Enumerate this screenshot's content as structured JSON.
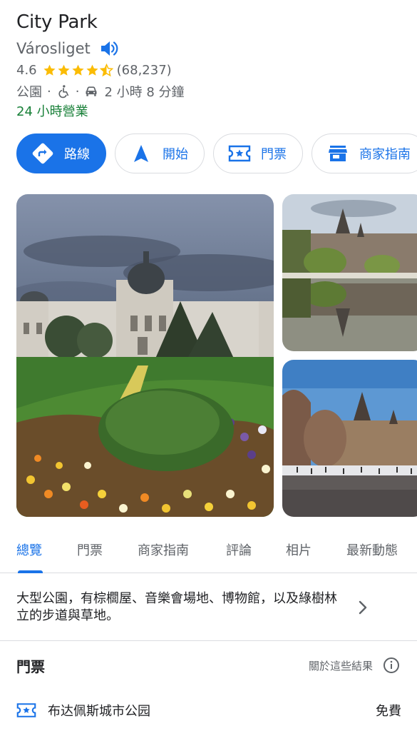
{
  "place": {
    "title": "City Park",
    "subtitle": "Városliget",
    "rating": "4.6",
    "stars": 4.6,
    "review_count": "(68,237)",
    "category": "公園",
    "dot": "·",
    "drive_time": "2 小時 8 分鐘",
    "hours_status": "24 小時營業"
  },
  "actions": [
    {
      "label": "路線",
      "icon": "directions-icon"
    },
    {
      "label": "開始",
      "icon": "navigation-arrow-icon"
    },
    {
      "label": "門票",
      "icon": "ticket-icon"
    },
    {
      "label": "商家指南",
      "icon": "store-icon"
    }
  ],
  "tabs": [
    {
      "label": "總覽",
      "active": true
    },
    {
      "label": "門票"
    },
    {
      "label": "商家指南"
    },
    {
      "label": "評論"
    },
    {
      "label": "相片"
    },
    {
      "label": "最新動態"
    }
  ],
  "description": "大型公園，有棕櫚屋、音樂會場地、博物館，以及綠樹林立的步道與草地。",
  "tickets": {
    "heading": "門票",
    "about_link": "關於這些結果",
    "items": [
      {
        "name": "布达佩斯城市公园",
        "price": "免費"
      }
    ]
  },
  "colors": {
    "accent": "#1a73e8",
    "star": "#fbbc04",
    "open_green": "#188038",
    "secondary_text": "#5f6368",
    "divider": "#dadce0"
  }
}
